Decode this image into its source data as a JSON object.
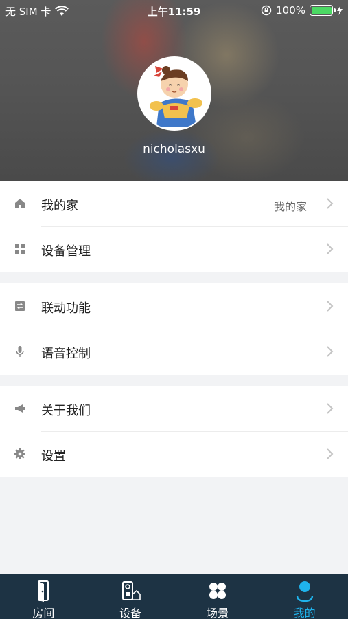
{
  "status_bar": {
    "carrier": "无 SIM 卡",
    "time": "上午11:59",
    "battery": "100%",
    "icons": [
      "wifi-icon",
      "orientation-lock-icon",
      "battery-icon",
      "charging-icon"
    ]
  },
  "profile": {
    "username": "nicholasxu",
    "avatar": "cartoon-avatar"
  },
  "menu": {
    "home": {
      "label": "我的家",
      "value": "我的家",
      "icon": "home-icon"
    },
    "device_management": {
      "label": "设备管理",
      "icon": "grid-icon"
    },
    "linkage": {
      "label": "联动功能",
      "icon": "linkage-icon"
    },
    "voice_control": {
      "label": "语音控制",
      "icon": "microphone-icon"
    },
    "about_us": {
      "label": "关于我们",
      "icon": "megaphone-icon"
    },
    "settings": {
      "label": "设置",
      "icon": "gear-icon"
    }
  },
  "tabbar": {
    "tabs": [
      {
        "label": "房间",
        "icon": "door-icon",
        "active": false
      },
      {
        "label": "设备",
        "icon": "device-icon",
        "active": false
      },
      {
        "label": "场景",
        "icon": "scene-icon",
        "active": false
      },
      {
        "label": "我的",
        "icon": "person-icon",
        "active": true
      }
    ],
    "active_color": "#1fb3ec",
    "background": "#1d3344"
  }
}
